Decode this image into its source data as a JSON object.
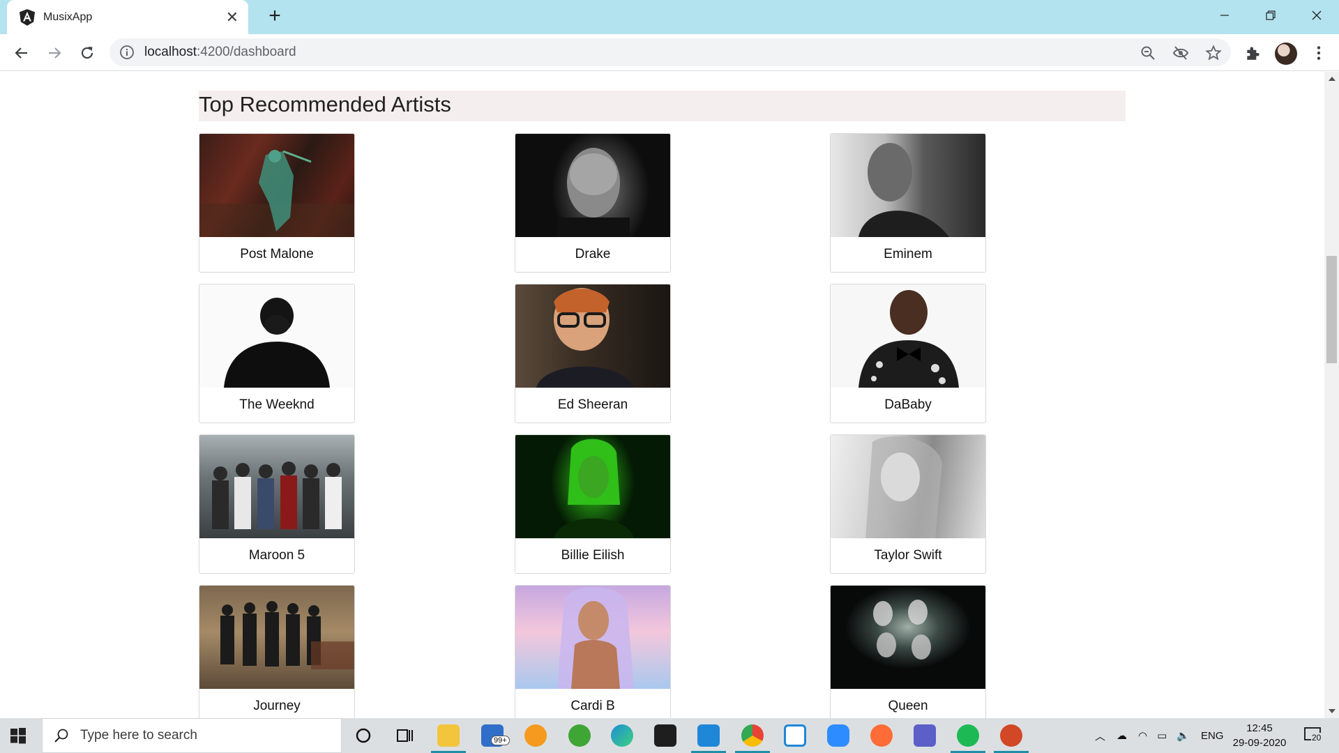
{
  "browser": {
    "tab_title": "MusixApp",
    "tab_close": "✕",
    "new_tab": "+",
    "url_host": "localhost",
    "url_path": ":4200/dashboard"
  },
  "page": {
    "heading": "Top Recommended Artists",
    "artists": [
      {
        "name": "Post Malone"
      },
      {
        "name": "Drake"
      },
      {
        "name": "Eminem"
      },
      {
        "name": "The Weeknd"
      },
      {
        "name": "Ed Sheeran"
      },
      {
        "name": "DaBaby"
      },
      {
        "name": "Maroon 5"
      },
      {
        "name": "Billie Eilish"
      },
      {
        "name": "Taylor Swift"
      },
      {
        "name": "Journey"
      },
      {
        "name": "Cardi B"
      },
      {
        "name": "Queen"
      }
    ]
  },
  "taskbar": {
    "search_placeholder": "Type here to search",
    "mail_badge": "99+",
    "language": "ENG",
    "time": "12:45",
    "date": "29-09-2020",
    "notifications": "20"
  },
  "colors": {
    "title_bar": "#b3e3ee",
    "heading_bar": "#f5eeee"
  }
}
